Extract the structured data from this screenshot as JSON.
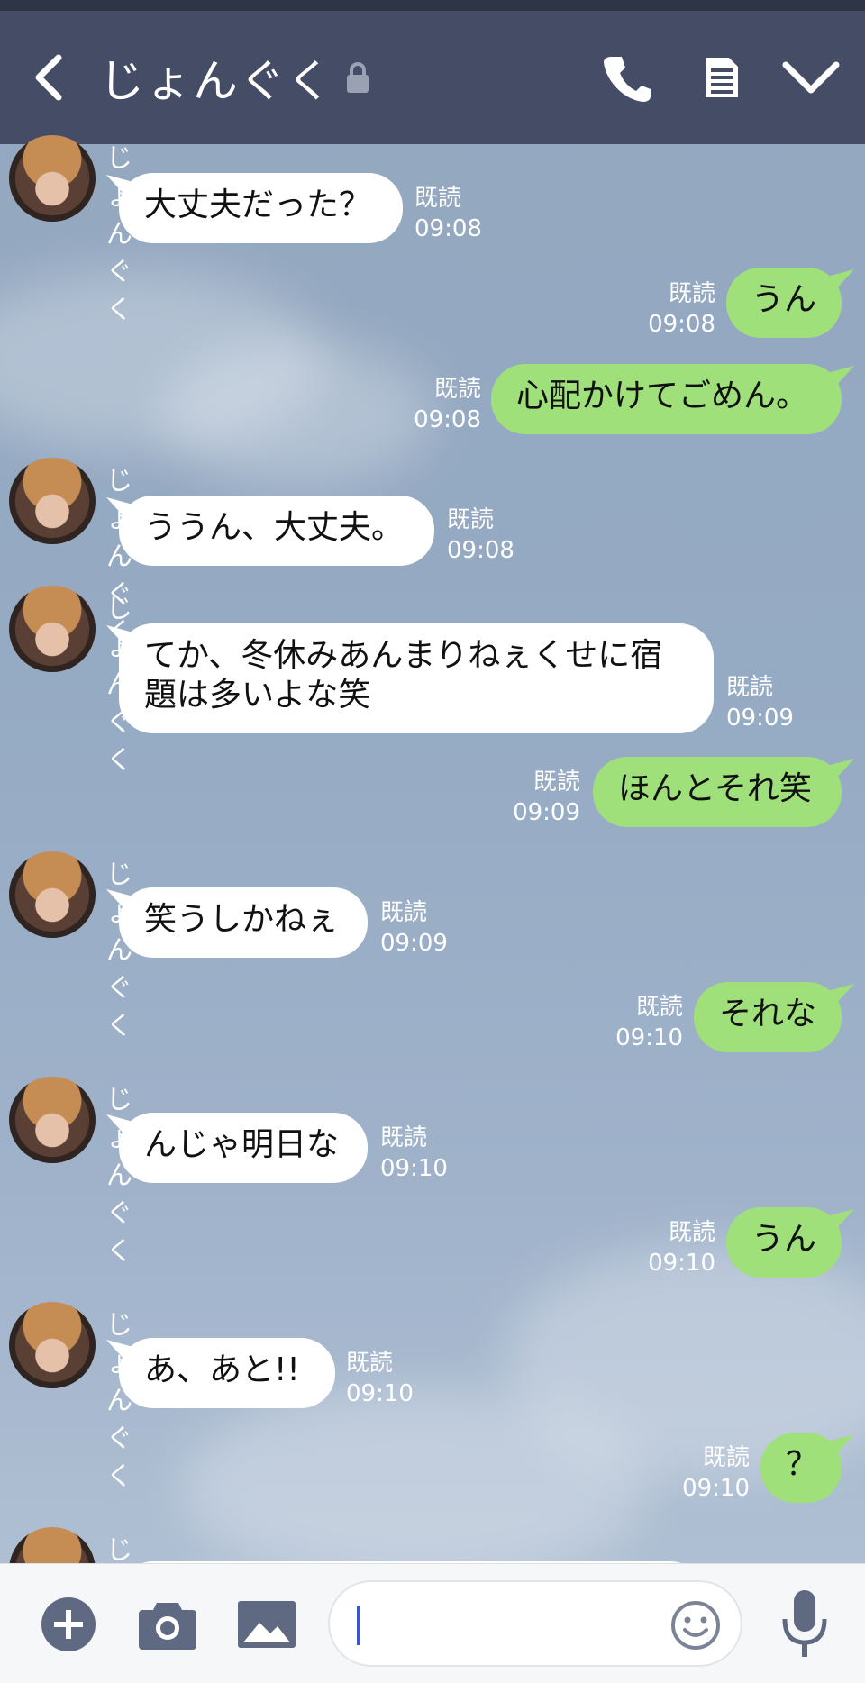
{
  "header": {
    "title": "じょんぐく",
    "colors": {
      "background": "#454d66",
      "status_strip": "#2d3547"
    },
    "icons": [
      "back-chevron-icon",
      "lock-icon",
      "phone-icon",
      "memo-icon",
      "chevron-down-icon"
    ]
  },
  "messages": [
    {
      "side": "in",
      "sender": "じょんぐく",
      "lines": [
        "大丈夫だった？"
      ],
      "read": "既読",
      "time": "09:08"
    },
    {
      "side": "out",
      "lines": [
        "うん"
      ],
      "read": "既読",
      "time": "09:08"
    },
    {
      "side": "out",
      "lines": [
        "心配かけてごめん。"
      ],
      "read": "既読",
      "time": "09:08"
    },
    {
      "side": "in",
      "sender": "じょんぐく",
      "lines": [
        "ううん、大丈夫。"
      ],
      "read": "既読",
      "time": "09:08"
    },
    {
      "side": "in",
      "sender": "じょんぐく",
      "lines": [
        "てか、冬休みあんまりねぇくせに宿",
        "題は多いよな笑"
      ],
      "read": "既読",
      "time": "09:09"
    },
    {
      "side": "out",
      "lines": [
        "ほんとそれ笑"
      ],
      "read": "既読",
      "time": "09:09"
    },
    {
      "side": "in",
      "sender": "じょんぐく",
      "lines": [
        "笑うしかねぇ"
      ],
      "read": "既読",
      "time": "09:09"
    },
    {
      "side": "out",
      "lines": [
        "それな"
      ],
      "read": "既読",
      "time": "09:10"
    },
    {
      "side": "in",
      "sender": "じょんぐく",
      "lines": [
        "んじゃ明日な"
      ],
      "read": "既読",
      "time": "09:10"
    },
    {
      "side": "out",
      "lines": [
        "うん"
      ],
      "read": "既読",
      "time": "09:10"
    },
    {
      "side": "in",
      "sender": "じょんぐく",
      "lines": [
        "あ、あと!!"
      ],
      "read": "既読",
      "time": "09:10"
    },
    {
      "side": "out",
      "lines": [
        "？"
      ],
      "read": "既読",
      "time": "09:10"
    },
    {
      "side": "in",
      "sender": "じょんぐく",
      "lines": [],
      "read": "",
      "time": ""
    }
  ],
  "input_bar": {
    "placeholder": "",
    "icons": [
      "plus-icon",
      "camera-icon",
      "image-icon",
      "emoji-icon",
      "microphone-icon"
    ]
  },
  "colors": {
    "incoming_bubble": "#ffffff",
    "outgoing_bubble": "#a0e07a",
    "meta_text": "#ffffff"
  }
}
